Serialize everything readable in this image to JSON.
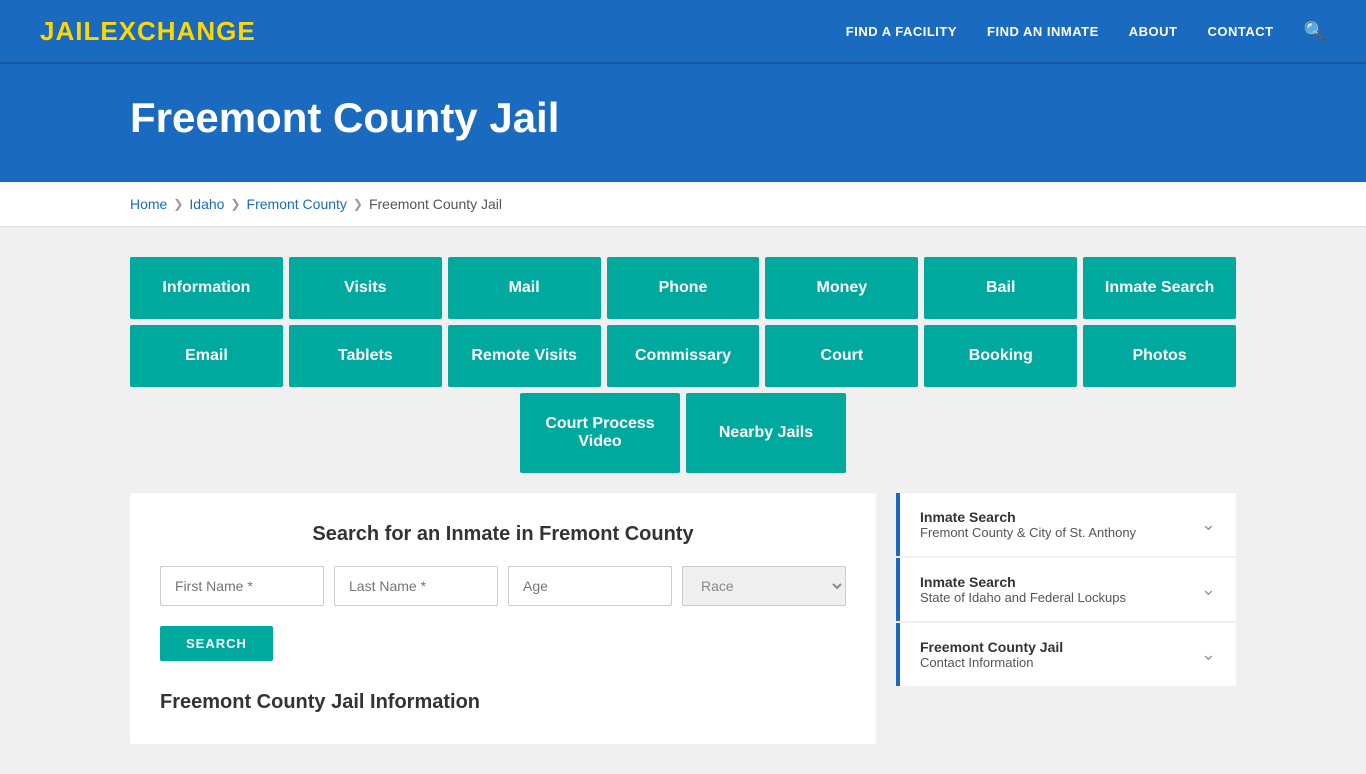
{
  "header": {
    "logo_jail": "JAIL",
    "logo_exchange": "EXCHANGE",
    "nav": [
      {
        "label": "FIND A FACILITY",
        "id": "find-facility"
      },
      {
        "label": "FIND AN INMATE",
        "id": "find-inmate"
      },
      {
        "label": "ABOUT",
        "id": "about"
      },
      {
        "label": "CONTACT",
        "id": "contact"
      }
    ]
  },
  "hero": {
    "title": "Freemont County Jail"
  },
  "breadcrumb": {
    "items": [
      {
        "label": "Home",
        "id": "bc-home"
      },
      {
        "label": "Idaho",
        "id": "bc-idaho"
      },
      {
        "label": "Fremont County",
        "id": "bc-fremont-county"
      },
      {
        "label": "Freemont County Jail",
        "id": "bc-jail"
      }
    ]
  },
  "grid_row1": [
    {
      "label": "Information",
      "id": "btn-information"
    },
    {
      "label": "Visits",
      "id": "btn-visits"
    },
    {
      "label": "Mail",
      "id": "btn-mail"
    },
    {
      "label": "Phone",
      "id": "btn-phone"
    },
    {
      "label": "Money",
      "id": "btn-money"
    },
    {
      "label": "Bail",
      "id": "btn-bail"
    },
    {
      "label": "Inmate Search",
      "id": "btn-inmate-search"
    }
  ],
  "grid_row2": [
    {
      "label": "Email",
      "id": "btn-email"
    },
    {
      "label": "Tablets",
      "id": "btn-tablets"
    },
    {
      "label": "Remote Visits",
      "id": "btn-remote-visits"
    },
    {
      "label": "Commissary",
      "id": "btn-commissary"
    },
    {
      "label": "Court",
      "id": "btn-court"
    },
    {
      "label": "Booking",
      "id": "btn-booking"
    },
    {
      "label": "Photos",
      "id": "btn-photos"
    }
  ],
  "grid_row3": [
    {
      "label": "Court Process Video",
      "id": "btn-court-process-video"
    },
    {
      "label": "Nearby Jails",
      "id": "btn-nearby-jails"
    }
  ],
  "inmate_search": {
    "title": "Search for an Inmate in Fremont County",
    "first_name_placeholder": "First Name *",
    "last_name_placeholder": "Last Name *",
    "age_placeholder": "Age",
    "race_placeholder": "Race",
    "search_button_label": "SEARCH"
  },
  "section_title": "Freemont County Jail Information",
  "sidebar": {
    "cards": [
      {
        "label": "Inmate Search",
        "sub": "Fremont County & City of St. Anthony",
        "id": "sidebar-inmate-search-1"
      },
      {
        "label": "Inmate Search",
        "sub": "State of Idaho and Federal Lockups",
        "id": "sidebar-inmate-search-2"
      },
      {
        "label": "Freemont County Jail",
        "sub": "Contact Information",
        "id": "sidebar-contact-info"
      }
    ]
  }
}
